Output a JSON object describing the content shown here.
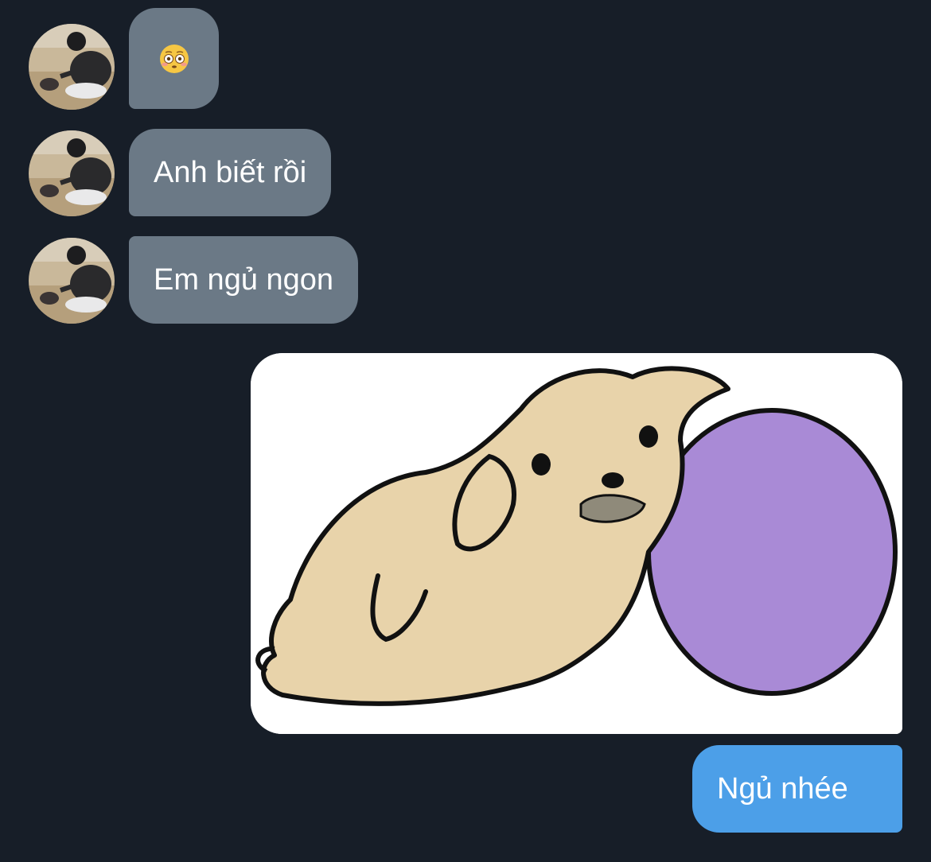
{
  "conversation": {
    "incoming": [
      {
        "emoji_icon": "flushed-face-icon"
      },
      {
        "text": "Anh biết rồi"
      },
      {
        "text": "Em ngủ ngon"
      }
    ],
    "outgoing": [
      {
        "sticker_icon": "sleepy-dog-with-ball-sticker"
      },
      {
        "text": "Ngủ nhée"
      }
    ]
  },
  "colors": {
    "background": "#171e28",
    "incoming_bubble": "#6b7986",
    "outgoing_bubble": "#4c9fe8",
    "text": "#ffffff"
  }
}
